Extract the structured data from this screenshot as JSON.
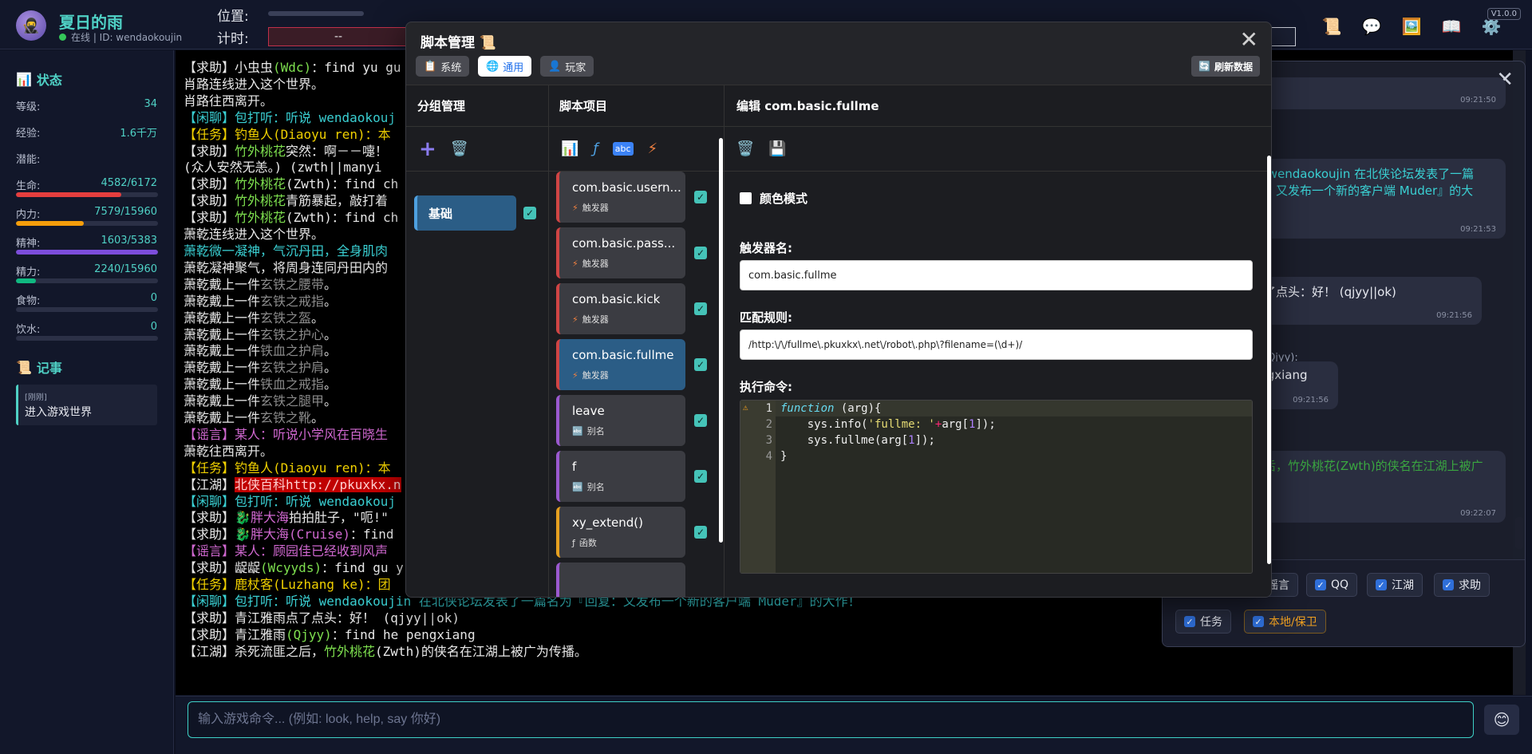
{
  "header": {
    "avatar_icon": "🥷",
    "name": "夏日的雨",
    "status": "在线 | ID: wendaokoujin",
    "location_label": "位置:",
    "timer_label": "计时:",
    "timer_value": "--",
    "version": "V1.0.0",
    "icons": [
      "scroll-icon",
      "chat-icon",
      "image-icon",
      "book-icon",
      "gear-icon"
    ]
  },
  "status_panel": {
    "title": "状态",
    "stats": [
      {
        "label": "等级:",
        "value": "34"
      },
      {
        "label": "经验:",
        "value": "1.6千万"
      },
      {
        "label": "潜能:",
        "value": ""
      },
      {
        "label": "生命:",
        "value": "4582/6172",
        "fraction": 0.742,
        "color": "#e53e3e"
      },
      {
        "label": "内力:",
        "value": "7579/15960",
        "fraction": 0.475,
        "color": "#f59e0b"
      },
      {
        "label": "精神:",
        "value": "1603/5383",
        "fraction": 1.0,
        "color": "#7c4ddb"
      },
      {
        "label": "精力:",
        "value": "2240/15960",
        "fraction": 0.14,
        "color": "#10b981"
      },
      {
        "label": "食物:",
        "value": "0",
        "fraction": 0.0,
        "color": "#ef4444"
      },
      {
        "label": "饮水:",
        "value": "0",
        "fraction": 0.0,
        "color": "#3b82f6"
      }
    ]
  },
  "log_panel": {
    "title": "记事",
    "entry_time": "[刚刚]",
    "entry_text": "进入游戏世界"
  },
  "terminal_lines": [
    [
      [
        "w",
        "【求助】小虫虫"
      ],
      [
        "g",
        "(Wdc)"
      ],
      [
        "w",
        "：find yu gu"
      ]
    ],
    [
      [
        "w",
        "肖路连线进入这个世界。"
      ]
    ],
    [
      [
        "w",
        "肖路往西离开。"
      ]
    ],
    [
      [
        "c",
        "【闲聊】包打听：听说 wendaokouj"
      ]
    ],
    [
      [
        "y",
        "【任务】钓鱼人(Diaoyu ren)：本"
      ]
    ],
    [
      [
        "w",
        "【求助】"
      ],
      [
        "g",
        "竹外桃花"
      ],
      [
        "w",
        "突然：啊－－嚏！"
      ]
    ],
    [
      [
        "w",
        "(众人安然无恙。) (zwth||manyi"
      ]
    ],
    [
      [
        "w",
        "【求助】"
      ],
      [
        "g",
        "竹外桃花"
      ],
      [
        "w",
        "(Zwth)：find ch"
      ]
    ],
    [
      [
        "w",
        "【求助】"
      ],
      [
        "g",
        "竹外桃花"
      ],
      [
        "w",
        "青筋暴起，敲打着"
      ]
    ],
    [
      [
        "w",
        "【求助】"
      ],
      [
        "g",
        "竹外桃花"
      ],
      [
        "w",
        "(Zwth)：find ch"
      ]
    ],
    [
      [
        "w",
        "萧乾连线进入这个世界。"
      ]
    ],
    [
      [
        "c",
        "萧乾微一凝神，气沉丹田，全身肌肉"
      ]
    ],
    [
      [
        "w",
        "萧乾凝神聚气，将周身连同丹田内的"
      ]
    ],
    [
      [
        "w",
        "萧乾戴上一件"
      ],
      [
        "gr",
        "玄铁之腰带"
      ],
      [
        "w",
        "。"
      ]
    ],
    [
      [
        "w",
        "萧乾戴上一件"
      ],
      [
        "gr",
        "玄铁之戒指"
      ],
      [
        "w",
        "。"
      ]
    ],
    [
      [
        "w",
        "萧乾戴上一件"
      ],
      [
        "gr",
        "玄铁之盔"
      ],
      [
        "w",
        "。"
      ]
    ],
    [
      [
        "w",
        "萧乾戴上一件"
      ],
      [
        "gr",
        "玄铁之护心"
      ],
      [
        "w",
        "。"
      ]
    ],
    [
      [
        "w",
        "萧乾戴上一件"
      ],
      [
        "gr",
        "铁血之护肩"
      ],
      [
        "w",
        "。"
      ]
    ],
    [
      [
        "w",
        "萧乾戴上一件"
      ],
      [
        "gr",
        "玄铁之护肩"
      ],
      [
        "w",
        "。"
      ]
    ],
    [
      [
        "w",
        "萧乾戴上一件"
      ],
      [
        "gr",
        "铁血之戒指"
      ],
      [
        "w",
        "。"
      ]
    ],
    [
      [
        "w",
        "萧乾戴上一件"
      ],
      [
        "gr",
        "玄铁之腿甲"
      ],
      [
        "w",
        "。"
      ]
    ],
    [
      [
        "w",
        "萧乾戴上一件"
      ],
      [
        "gr",
        "玄铁之靴"
      ],
      [
        "w",
        "。"
      ]
    ],
    [
      [
        "m",
        "【谣言】某人：听说小学风在百晓生"
      ]
    ],
    [
      [
        "w",
        "萧乾往西离开。"
      ]
    ],
    [
      [
        "y",
        "【任务】钓鱼人(Diaoyu ren)：本"
      ]
    ],
    [
      [
        "w",
        "【江湖】"
      ],
      [
        "hl",
        "北侠百科http://pkuxkx.n"
      ]
    ],
    [
      [
        "c",
        "【闲聊】包打听：听说 wendaokouj"
      ]
    ],
    [
      [
        "w",
        "【求助】"
      ],
      [
        "m",
        "🐉胖大海"
      ],
      [
        "w",
        "拍拍肚子，\"呃!\""
      ]
    ],
    [
      [
        "w",
        "【求助】"
      ],
      [
        "m",
        "🐉胖大海(Cruise)"
      ],
      [
        "w",
        "：find"
      ]
    ],
    [
      [
        "m",
        "【谣言】某人：顾园佳已经收到风声"
      ]
    ],
    [
      [
        "w",
        "【求助】龊龊"
      ],
      [
        "g",
        "(Wcyyds)"
      ],
      [
        "w",
        "：find gu y"
      ]
    ],
    [
      [
        "y",
        "【任务】鹿杖客(Luzhang ke)：团"
      ]
    ],
    [
      [
        "c",
        "【闲聊】包打听：听说 wendaokoujin 在北侠论坛发表了一篇名为『回复：又发布一个新的客户端 Muder』的大作！"
      ]
    ],
    [
      [
        "w",
        "【求助】青江雅雨点了点头：好！ (qjyy||ok)"
      ]
    ],
    [
      [
        "w",
        "【求助】青江雅雨"
      ],
      [
        "g",
        "(Qjyy)"
      ],
      [
        "w",
        "：find he pengxiang"
      ]
    ],
    [
      [
        "w",
        "【江湖】杀死流匪之后，"
      ],
      [
        "g",
        "竹外桃花"
      ],
      [
        "w",
        "(Zwth)的侠名在江湖上被广为传播。"
      ]
    ]
  ],
  "input": {
    "placeholder": "输入游戏命令... (例如: look, help, say 你好)",
    "emoji": "😊"
  },
  "chat": {
    "bubbles": [
      {
        "text": "",
        "time": "09:21:50"
      },
      {
        "text": "说 wendaokoujin 在北侠论坛发表了一篇\n复：又发布一个新的客户端 Muder』的大",
        "time": "09:21:53",
        "color": "#3ad0d3"
      },
      {
        "text": "点了点头：好！ (qjyy||ok)",
        "time": "09:21:56",
        "color": "#e6e8ef"
      },
      {
        "text": "雅雨(Qjyy):",
        "time": "",
        "color": "#9aa3b8"
      },
      {
        "text": "engxiang",
        "time": "09:21:56",
        "color": "#e6e8ef"
      },
      {
        "text": "之后，竹外桃花(Zwth)的侠名在江湖上被广",
        "time": "09:22:07",
        "color": "#3aa640"
      }
    ],
    "filters": [
      "谣言",
      "QQ",
      "江湖",
      "求助",
      "任务",
      "本地/保卫"
    ]
  },
  "modal": {
    "title": "脚本管理",
    "tabs": [
      {
        "icon": "📋",
        "label": "系统"
      },
      {
        "icon": "🌐",
        "label": "通用"
      },
      {
        "icon": "👤",
        "label": "玩家"
      }
    ],
    "refresh_label": "刷新数据",
    "group_header": "分组管理",
    "script_header": "脚本项目",
    "editor_header": "编辑 com.basic.fullme",
    "group_name": "基础",
    "scripts": [
      {
        "name": "com.basic.usern...",
        "type": "触发器",
        "kind": "trigger"
      },
      {
        "name": "com.basic.pass...",
        "type": "触发器",
        "kind": "trigger"
      },
      {
        "name": "com.basic.kick",
        "type": "触发器",
        "kind": "trigger"
      },
      {
        "name": "com.basic.fullme",
        "type": "触发器",
        "kind": "trigger",
        "selected": true
      },
      {
        "name": "leave",
        "type": "别名",
        "kind": "alias"
      },
      {
        "name": "f",
        "type": "别名",
        "kind": "alias"
      },
      {
        "name": "xy_extend()",
        "type": "函数",
        "kind": "func"
      }
    ],
    "color_mode_label": "颜色模式",
    "trigger_label": "触发器名:",
    "trigger_value": "com.basic.fullme",
    "rule_label": "匹配规则:",
    "rule_value": "/http:\\/\\/fullme\\.pkuxkx\\.net\\/robot\\.php\\?filename=(\\d+)/",
    "command_label": "执行命令:",
    "code_lines": [
      "function (arg){",
      "    sys.info('fullme: '+arg[1]);",
      "    sys.fullme(arg[1]);",
      "}"
    ]
  }
}
